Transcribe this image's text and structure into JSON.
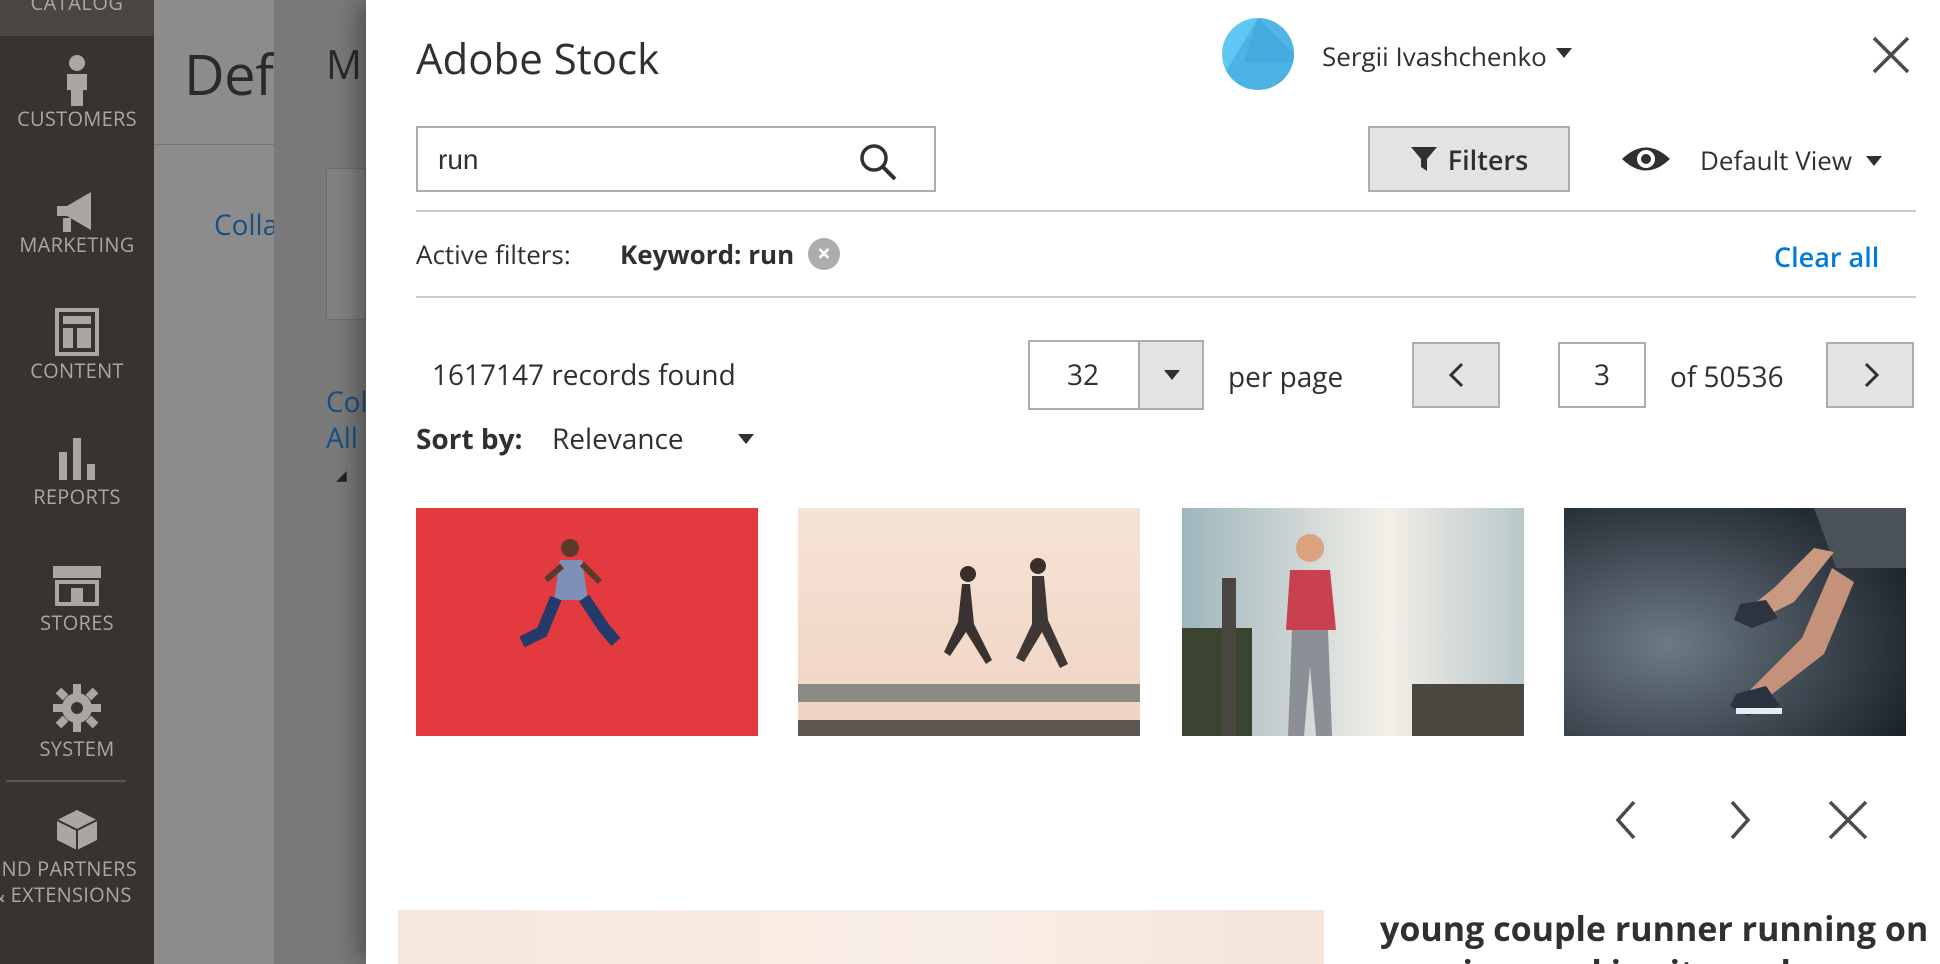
{
  "sidebar": {
    "catalog_label": "CATALOG",
    "items": [
      {
        "label": "CUSTOMERS",
        "icon": "person-icon"
      },
      {
        "label": "MARKETING",
        "icon": "megaphone-icon"
      },
      {
        "label": "CONTENT",
        "icon": "layout-icon"
      },
      {
        "label": "REPORTS",
        "icon": "bar-chart-icon"
      },
      {
        "label": "STORES",
        "icon": "storefront-icon"
      },
      {
        "label": "SYSTEM",
        "icon": "gear-icon"
      },
      {
        "label_line1": "FIND PARTNERS",
        "label_line2": "& EXTENSIONS",
        "icon": "blocks-icon"
      }
    ]
  },
  "background": {
    "page_title": "Def",
    "panel_title": "M",
    "link1": "Colla",
    "link2_line1": "Col",
    "link2_line2": "All"
  },
  "modal": {
    "title": "Adobe Stock",
    "user_name": "Sergii Ivashchenko",
    "search": {
      "value": "run",
      "placeholder": ""
    },
    "filters_label": "Filters",
    "view_label": "Default View",
    "active_filters_label": "Active filters:",
    "active_filter_chip": "Keyword: run",
    "clear_all": "Clear all",
    "records_found": "1617147 records found",
    "per_page_value": "32",
    "per_page_label": "per page",
    "current_page": "3",
    "total_pages": "of 50536",
    "sort_label": "Sort by:",
    "sort_value": "Relevance",
    "preview_title_line1": "young couple runner running on",
    "preview_title_line2": "running road in city park"
  },
  "colors": {
    "sidebar_bg": "#373330",
    "link_blue": "#007bdb",
    "avatar_blue": "#5ec8f2",
    "button_gray": "#e3e3e3"
  }
}
